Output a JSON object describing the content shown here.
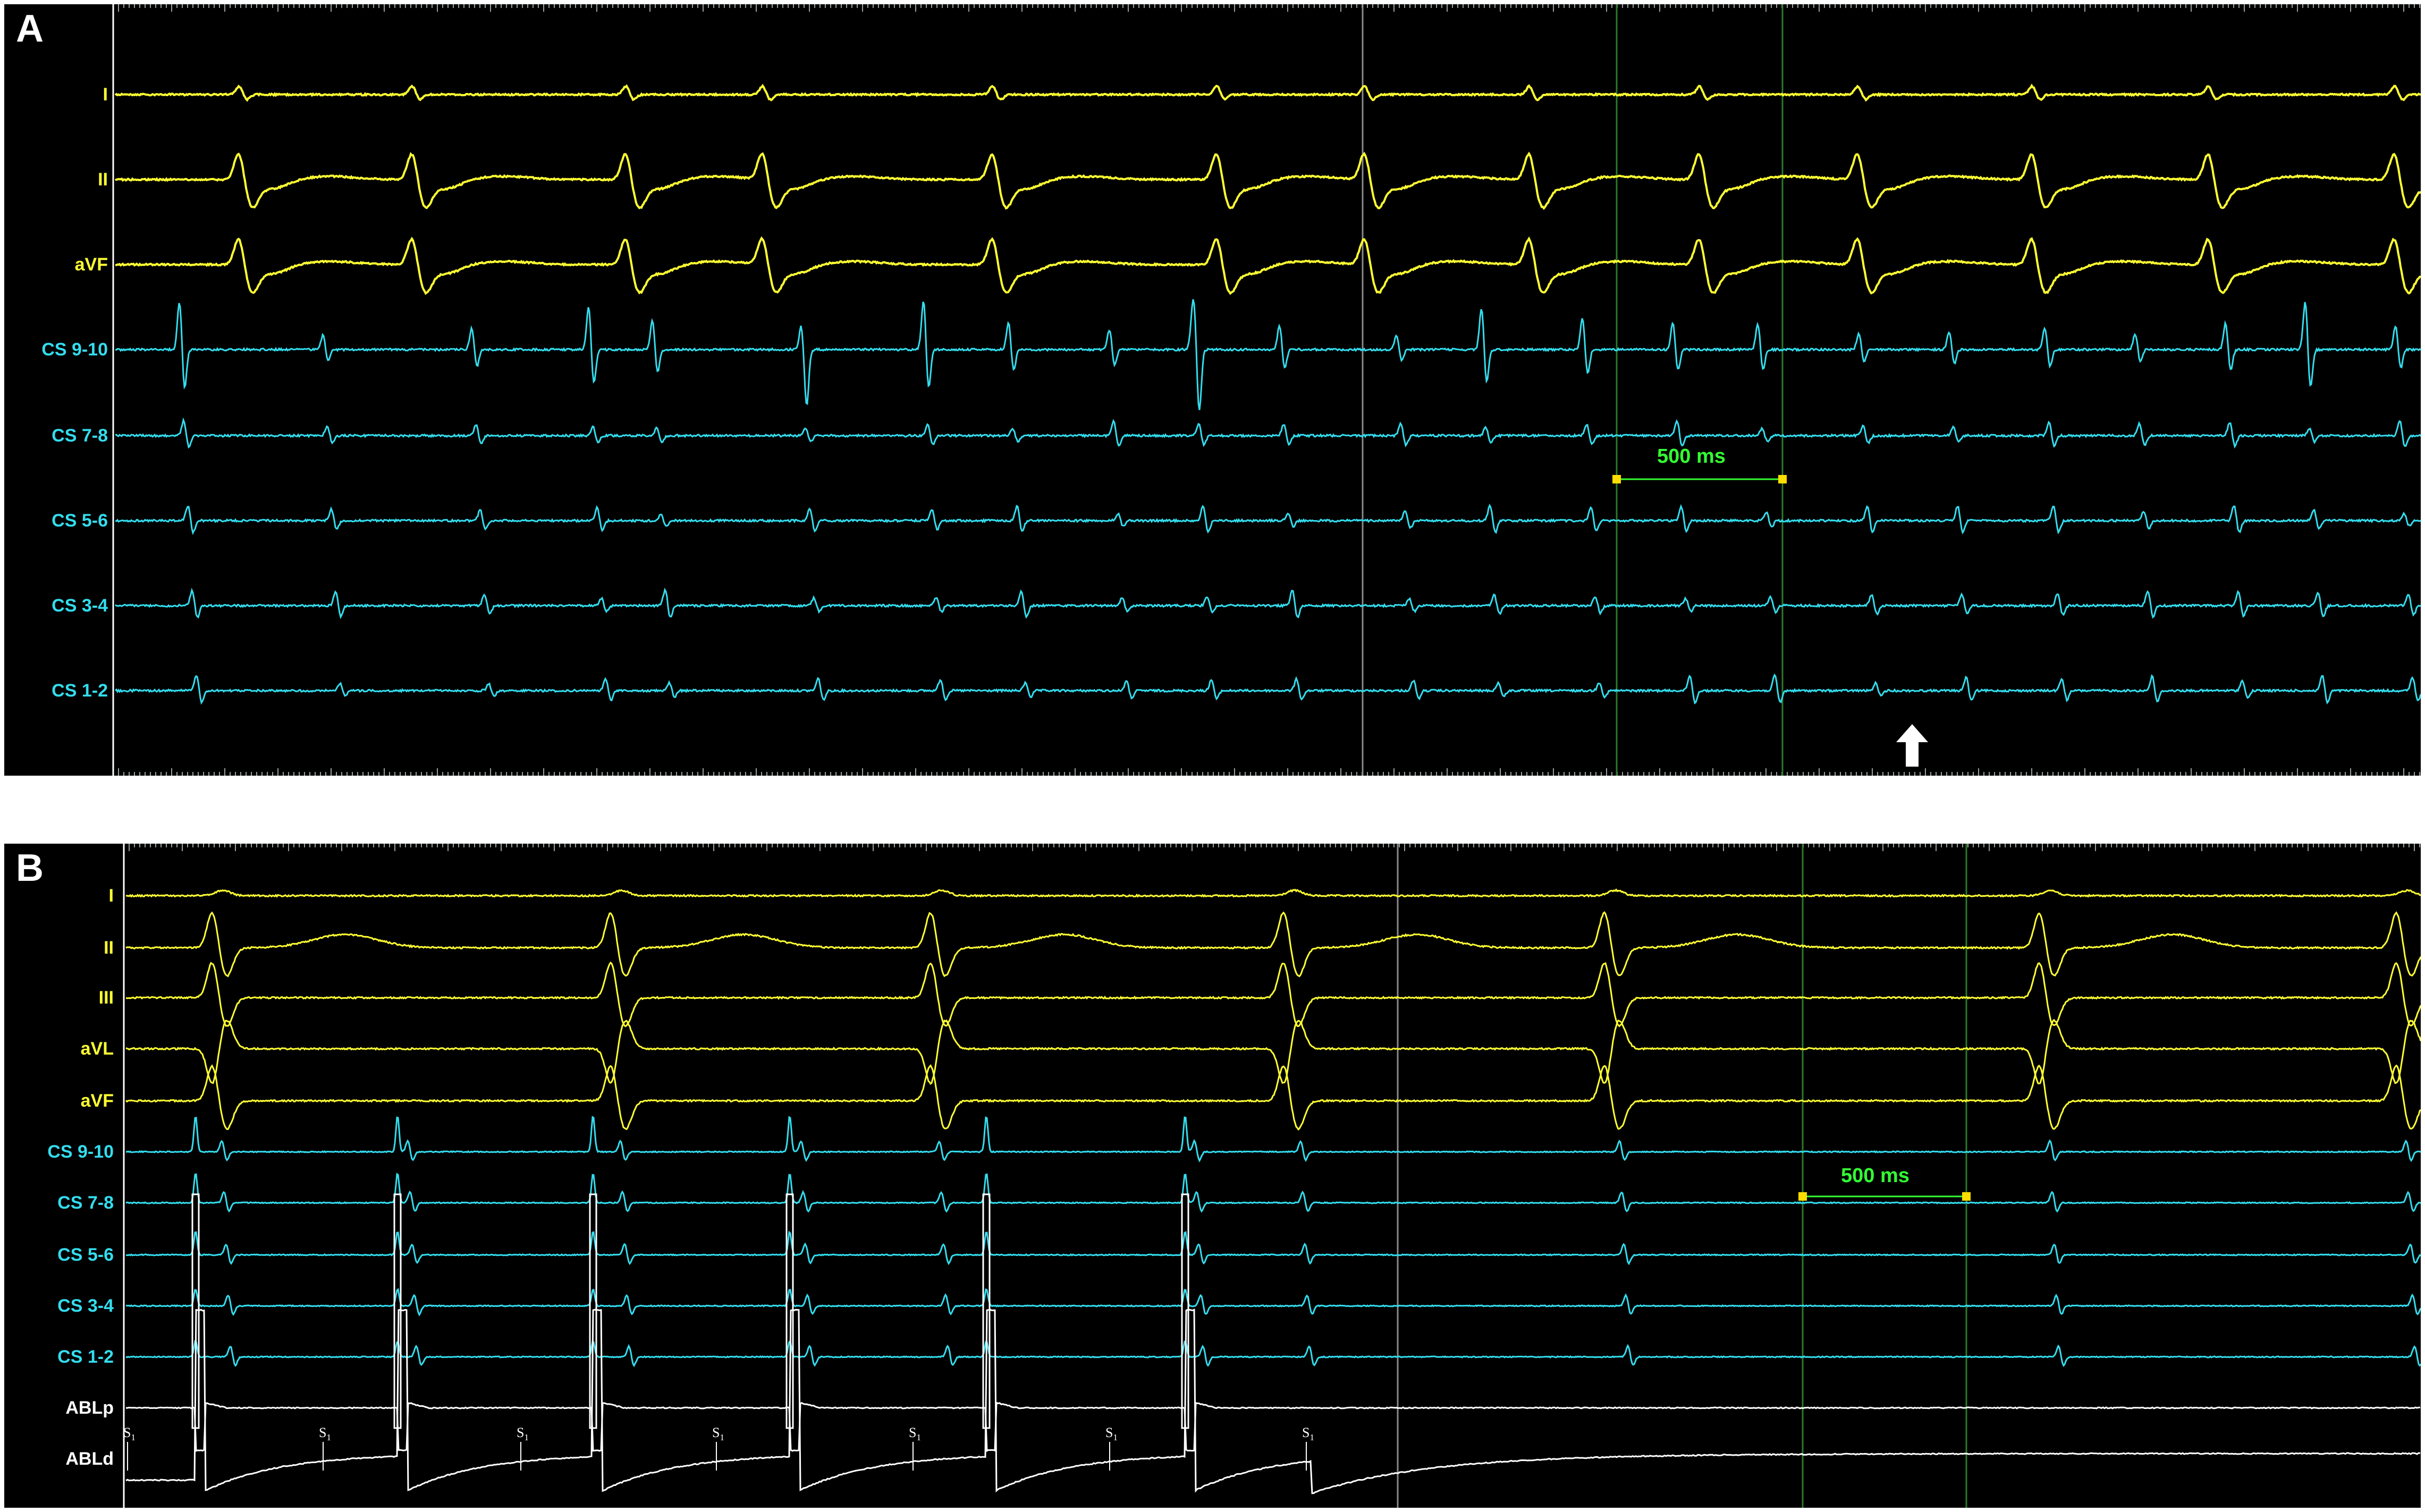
{
  "panels": [
    {
      "letter": "A",
      "leads": [
        {
          "label": "I",
          "color": "#ffff33"
        },
        {
          "label": "II",
          "color": "#ffff33"
        },
        {
          "label": "aVF",
          "color": "#ffff33"
        },
        {
          "label": "CS 9-10",
          "color": "#33ddee"
        },
        {
          "label": "CS 7-8",
          "color": "#33ddee"
        },
        {
          "label": "CS 5-6",
          "color": "#33ddee"
        },
        {
          "label": "CS 3-4",
          "color": "#33ddee"
        },
        {
          "label": "CS 1-2",
          "color": "#33ddee"
        }
      ],
      "caliper_label": "500 ms",
      "arrow_icon": "up-arrow-icon"
    },
    {
      "letter": "B",
      "leads": [
        {
          "label": "I",
          "color": "#ffff33"
        },
        {
          "label": "II",
          "color": "#ffff33"
        },
        {
          "label": "III",
          "color": "#ffff33"
        },
        {
          "label": "aVL",
          "color": "#ffff33"
        },
        {
          "label": "aVF",
          "color": "#ffff33"
        },
        {
          "label": "CS 9-10",
          "color": "#33ddee"
        },
        {
          "label": "CS 7-8",
          "color": "#33ddee"
        },
        {
          "label": "CS 5-6",
          "color": "#33ddee"
        },
        {
          "label": "CS 3-4",
          "color": "#33ddee"
        },
        {
          "label": "CS 1-2",
          "color": "#33ddee"
        },
        {
          "label": "ABLp",
          "color": "#ffffff"
        },
        {
          "label": "ABLd",
          "color": "#ffffff"
        }
      ],
      "caliper_label": "500 ms",
      "stim_label_main": "S",
      "stim_label_sub": "1"
    }
  ],
  "colors": {
    "background": "#000000",
    "surface_ecg": "#ffff33",
    "intracardiac": "#33ddee",
    "ablation": "#ffffff",
    "caliper": "#33ff33",
    "caliper_marker": "#ffdd00",
    "grid_line": "#2a7a2a"
  }
}
